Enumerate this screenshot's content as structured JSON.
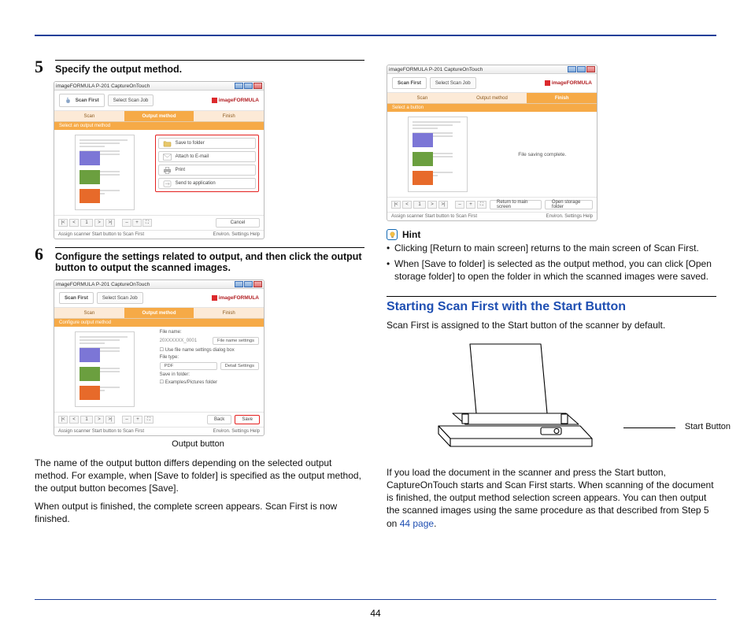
{
  "page_number": "44",
  "left": {
    "step5": {
      "num": "5",
      "title": "Specify the output method."
    },
    "step6": {
      "num": "6",
      "title": "Configure the settings related to output, and then click the output button to output the scanned images.",
      "caption": "Output button"
    },
    "para1": "The name of the output button differs depending on the selected output method. For example, when [Save to folder] is specified as the output method, the output button becomes [Save].",
    "para2": "When output is finished, the complete screen appears. Scan First is now finished."
  },
  "right": {
    "hint_label": "Hint",
    "hint_items": [
      "Clicking [Return to main screen] returns to the main screen of Scan First.",
      "When [Save to folder] is selected as the output method, you can click [Open storage folder] to open the folder in which the scanned images were saved."
    ],
    "section_title": "Starting Scan First with the Start Button",
    "intro": "Scan First is assigned to the Start button of the scanner by default.",
    "start_button_label": "Start Button",
    "outro_a": "If you load the document in the scanner and press the Start button, CaptureOnTouch starts and Scan First starts. When scanning of the document is finished, the output method selection screen appears. You can then output the scanned images using the same procedure as that described from Step 5 on ",
    "outro_link": "44 page",
    "outro_b": "."
  },
  "win": {
    "title": "imageFORMULA P-201 CaptureOnTouch",
    "mode_scan_first": "Scan First",
    "mode_select_job": "Select Scan Job",
    "brand": "imageFORMULA",
    "steps": {
      "scan": "Scan",
      "output": "Output method",
      "finish": "Finish"
    },
    "subhead_a": "Select an output method",
    "subhead_b": "Configure output method",
    "subhead_c": "Select a button",
    "opt": {
      "save": "Save to folder",
      "email": "Attach to E-mail",
      "print": "Print",
      "app": "Send to application"
    },
    "nav": {
      "first": "|<",
      "prev": "<",
      "page": "1",
      "next": ">",
      "last": ">|",
      "zin": "+",
      "zout": "–",
      "fit": "⛶"
    },
    "cancel": "Cancel",
    "status": "Assign scanner Start button to Scan First",
    "env": "Environ. Settings",
    "help": "Help",
    "settings": {
      "fn_label": "File name:",
      "fn_value": "20XXXXXX_0001",
      "fn_btn": "File name settings",
      "fn_chk": "Use file name settings dialog box",
      "ft_label": "File type:",
      "ft_value": "PDF",
      "ft_btn": "Detail Settings",
      "sv_label": "Save in folder:",
      "sv_value": "Examples/Pictures folder"
    },
    "back": "Back",
    "save": "Save",
    "complete": "File saving complete.",
    "return": "Return to main screen",
    "openfolder": "Open storage folder"
  }
}
